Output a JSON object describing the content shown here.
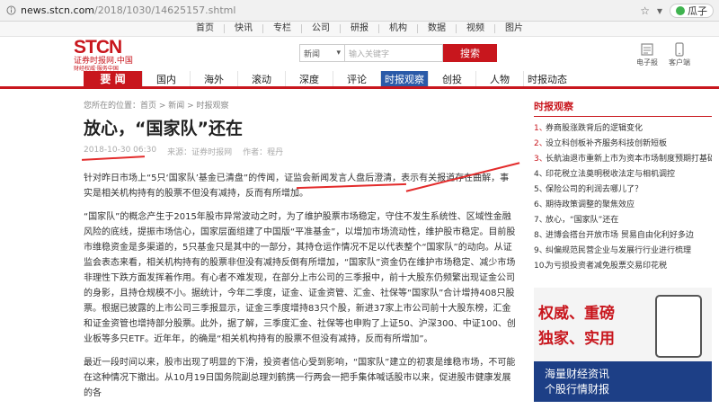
{
  "browser": {
    "host": "news.stcn.com",
    "path": "/2018/1030/14625157.shtml",
    "melon_label": "瓜子"
  },
  "topnav": [
    "首页",
    "快讯",
    "专栏",
    "公司",
    "研报",
    "机构",
    "数据",
    "视频",
    "图片"
  ],
  "logo": {
    "text": "STCN",
    "subtitle": "证券时报网.中国",
    "tagline": "财经权威·服务中国"
  },
  "search": {
    "select": "新闻",
    "placeholder": "输入关键字",
    "button": "搜索"
  },
  "apps": [
    {
      "label": "电子报"
    },
    {
      "label": "客户端"
    }
  ],
  "mainnav": {
    "home": "要 闻",
    "items": [
      "国内",
      "海外",
      "滚动",
      "深度",
      "评论",
      "时报观察",
      "创投",
      "人物",
      "时报动态"
    ],
    "active": "时报观察"
  },
  "breadcrumb": "您所在的位置：首页 > 新闻 > 时报观察",
  "article": {
    "title": "放心，“国家队”还在",
    "date": "2018-10-30 06:30",
    "source": "来源：证券时报网",
    "author": "作者：程丹",
    "paragraphs": [
      "针对昨日市场上“5只‘国家队’基金已清盘”的传闻，证监会新闻发言人盘后澄清，表示有关报道存在曲解，事实是相关机构持有的股票不但没有减持，反而有所增加。",
      "“国家队”的概念产生于2015年股市异常波动之时，为了维护股票市场稳定，守住不发生系统性、区域性金融风险的底线，提振市场信心，国家层面组建了中国版“平准基金”，以增加市场流动性，维护股市稳定。目前股市维稳资金是多渠道的，5只基金只是其中的一部分，其持仓运作情况不足以代表整个“国家队”的动向。从证监会表态来看，相关机构持有的股票非但没有减持反倒有所增加，“国家队”资金仍在维护市场稳定、减少市场非理性下跌方面发挥着作用。有心者不难发现，在部分上市公司的三季报中，前十大股东仍频繁出现证金公司的身影，且持仓规模不小。据统计，今年二季度，证金、证金资管、汇金、社保等“国家队”合计增持408只股票。根据已披露的上市公司三季报显示，证金三季度增持83只个股，新进37家上市公司前十大股东榜，汇金和证金资管也增持部分股票。此外，据了解，三季度汇金、社保等也申购了上证50、沪深300、中证100、创业板等多只ETF。近年年，的确是“相关机构持有的股票不但没有减持，反而有所增加”。",
      "最近一段时间以来，股市出现了明显的下滑，投资者信心受到影响，“国家队”建立的初衷是维稳市场，不可能在这种情况下撤出。从10月19日国务院副总理刘鹤携一行两会一把手集体喊话股市以来，促进股市健康发展的各"
    ]
  },
  "sidebar": {
    "heading": "时报观察",
    "items": [
      "券商股涨跌背后的逻辑变化",
      "设立科创板补齐服务科技创新短板",
      "长航油退市重新上市为资本市场制度预期打基础",
      "印花税立法奠明税收法定与相机调控",
      "保险公司的利润去哪儿了？",
      "期待政策调整的聚焦效应",
      "放心，“国家队”还在",
      "进博会搭台开放市场 贸易自由化利好多边",
      "纠偏规范民营企业与发展行行业进行梳理",
      "为亏损投资者减免股票交易印花税"
    ]
  },
  "ad": {
    "line1": "权威、重磅",
    "line2": "独家、实用",
    "line3": "海量财经资讯",
    "line4": "个股行情财报"
  },
  "colors": {
    "brand_red": "#c8161d",
    "nav_active": "#2a5aa8",
    "annotation": "#e32b2b"
  }
}
